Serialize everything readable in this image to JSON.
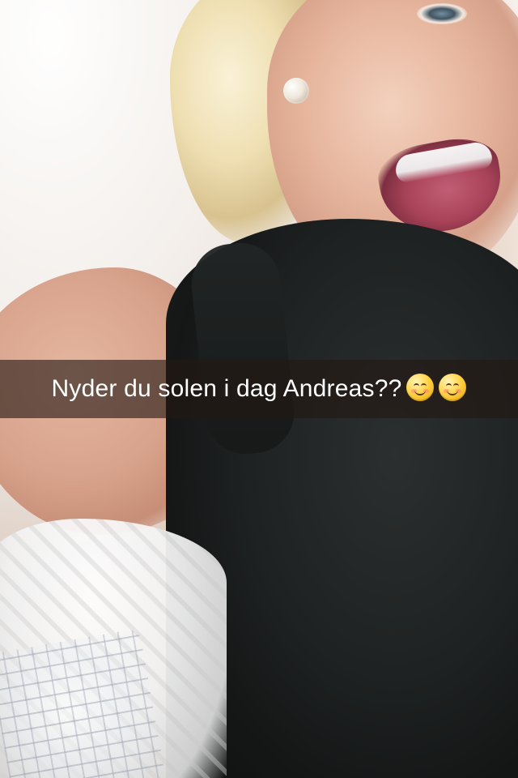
{
  "snap": {
    "caption": "Nyder du solen i dag Andreas??",
    "emojis": [
      "smiling-face-icon",
      "smiling-face-icon"
    ]
  }
}
